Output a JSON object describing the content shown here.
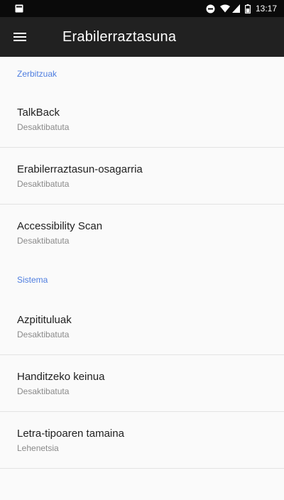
{
  "status_bar": {
    "time": "13:17",
    "icons": [
      "notification-icon",
      "do-not-disturb-icon",
      "wifi-icon",
      "signal-icon",
      "battery-icon"
    ]
  },
  "app_bar": {
    "title": "Erabilerraztasuna",
    "menu_icon": "hamburger-menu-icon"
  },
  "colors": {
    "status_bar_bg": "#0a0a0a",
    "app_bar_bg": "#212121",
    "section_header": "#4f7ee0",
    "background": "#fafafa"
  },
  "sections": {
    "services": {
      "header": "Zerbitzuak",
      "items": [
        {
          "title": "TalkBack",
          "summary": "Desaktibatuta"
        },
        {
          "title": "Erabilerraztasun-osagarria",
          "summary": "Desaktibatuta"
        },
        {
          "title": "Accessibility Scan",
          "summary": "Desaktibatuta"
        }
      ]
    },
    "system": {
      "header": "Sistema",
      "items": [
        {
          "title": "Azpitituluak",
          "summary": "Desaktibatuta"
        },
        {
          "title": "Handitzeko keinua",
          "summary": "Desaktibatuta"
        },
        {
          "title": "Letra-tipoaren tamaina",
          "summary": "Lehenetsia"
        }
      ]
    }
  }
}
